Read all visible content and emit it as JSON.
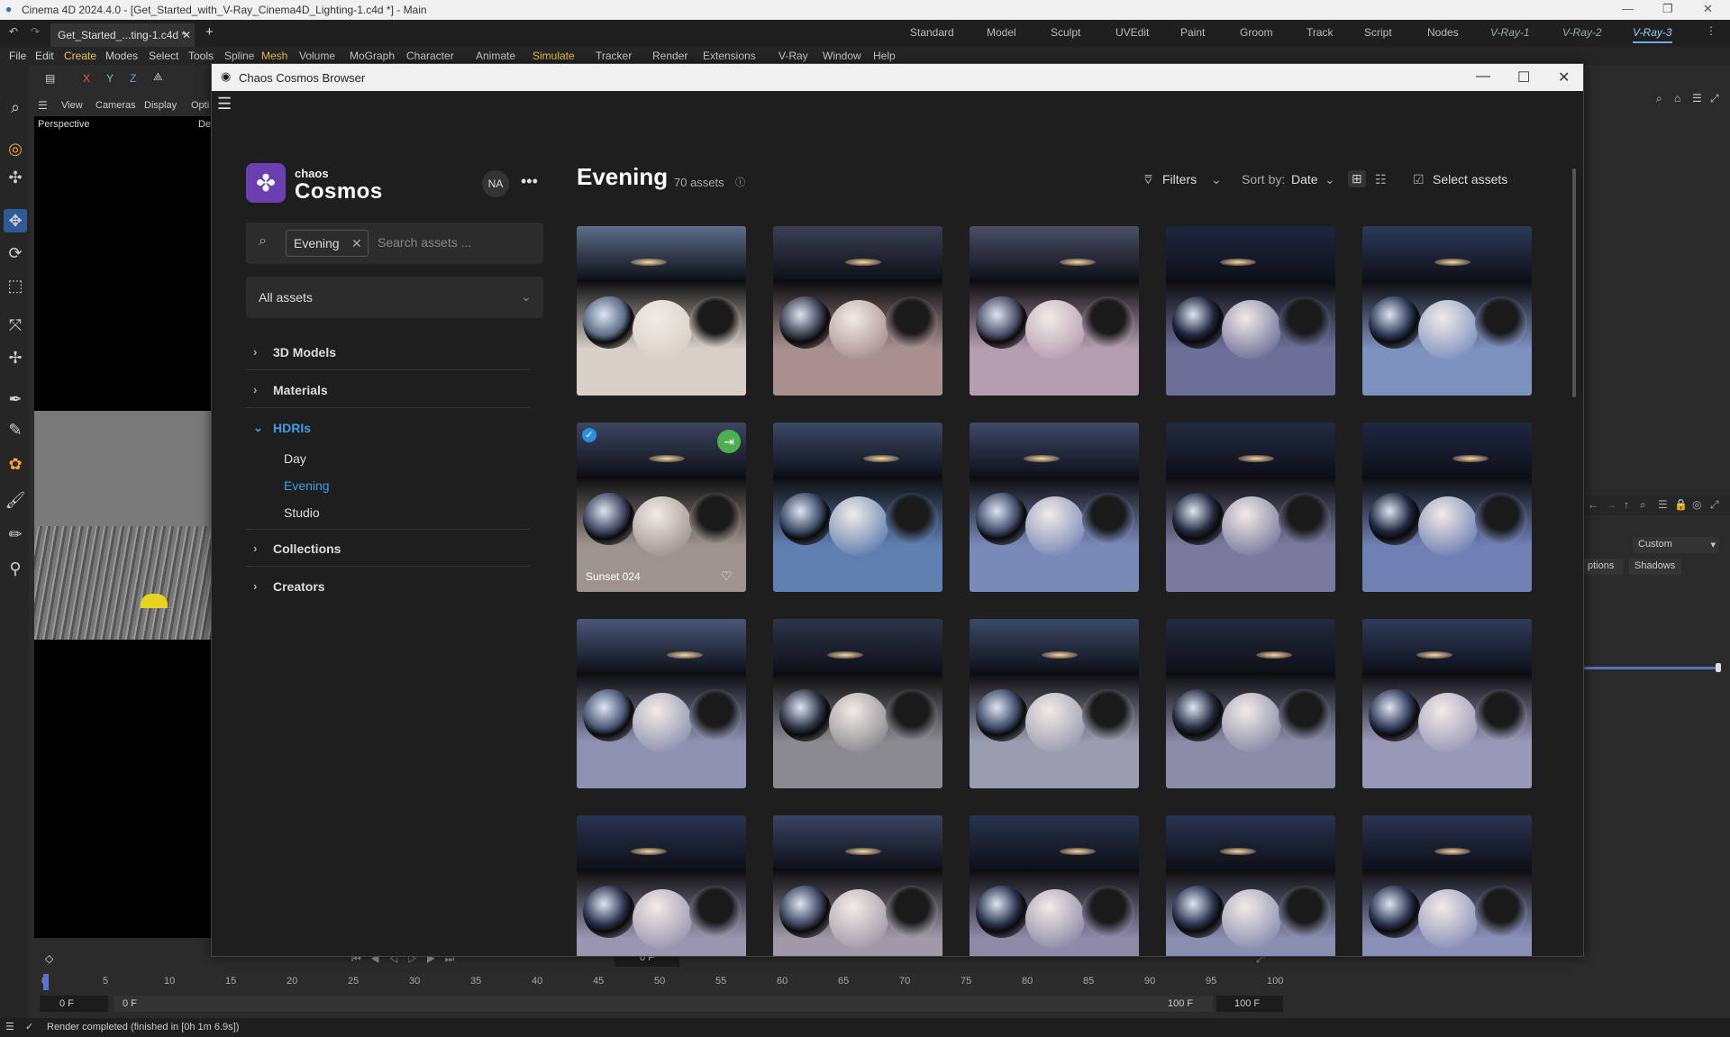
{
  "window": {
    "title": "Cinema 4D 2024.4.0 - [Get_Started_with_V-Ray_Cinema4D_Lighting-1.c4d *] - Main",
    "doc_tab": "Get_Started_...ting-1.c4d *",
    "layouts": [
      "Standard",
      "Model",
      "Sculpt",
      "UVEdit",
      "Paint",
      "Groom",
      "Track",
      "Script",
      "Nodes",
      "V-Ray-1",
      "V-Ray-2",
      "V-Ray-3"
    ],
    "active_layout": "V-Ray-3"
  },
  "menu": [
    "File",
    "Edit",
    "Create",
    "Modes",
    "Select",
    "Tools",
    "Spline",
    "Mesh",
    "Volume",
    "MoGraph",
    "Character",
    "Animate",
    "Simulate",
    "Tracker",
    "Render",
    "Extensions",
    "V-Ray",
    "Window",
    "Help"
  ],
  "viewport": {
    "menus": [
      "View",
      "Cameras",
      "Display",
      "Opti"
    ],
    "label": "Perspective",
    "label_right": "De"
  },
  "right_panel": {
    "dropdown": "Custom",
    "tab1": "ptions",
    "tab2": "Shadows"
  },
  "timeline": {
    "frame_field": "0 F",
    "ticks": [
      "0",
      "5",
      "10",
      "15",
      "20",
      "25",
      "30",
      "35",
      "40",
      "45",
      "50",
      "55",
      "60",
      "65",
      "70",
      "75",
      "80",
      "85",
      "90",
      "95",
      "100"
    ],
    "start": "0 F",
    "start2": "0 F",
    "end": "100 F",
    "end2": "100 F"
  },
  "status": {
    "text": "Render completed (finished in [0h  1m  6.9s])"
  },
  "dialog": {
    "title": "Chaos Cosmos Browser",
    "brand_small": "chaos",
    "brand": "Cosmos",
    "avatar": "NA",
    "search_chip": "Evening",
    "search_placeholder": "Search assets ...",
    "all_assets": "All assets",
    "categories": [
      "3D Models",
      "Materials",
      "HDRIs",
      "Collections",
      "Creators"
    ],
    "hdri_sub": [
      "Day",
      "Evening",
      "Studio"
    ],
    "grid_title": "Evening",
    "grid_count": "70 assets",
    "filters": "Filters",
    "sort_label": "Sort by:",
    "sort_value": "Date",
    "select_assets": "Select assets",
    "hovered_tile_label": "Sunset 024"
  },
  "tile_colors": {
    "row1": [
      [
        "#5d6e88",
        "#d8cfc8"
      ],
      [
        "#3a3f52",
        "#a89090"
      ],
      [
        "#4b4f66",
        "#b59eb0"
      ],
      [
        "#1f2740",
        "#6d6f99"
      ],
      [
        "#2c3a58",
        "#7e92c0"
      ]
    ],
    "row2": [
      [
        "#3e4660",
        "#9e938e"
      ],
      [
        "#3b4a66",
        "#5f7fb0"
      ],
      [
        "#3e4a68",
        "#7a8ab8"
      ],
      [
        "#222a40",
        "#7a7a9e"
      ],
      [
        "#1f2842",
        "#6f80b4"
      ]
    ],
    "row3": [
      [
        "#4a5878",
        "#8e92b0"
      ],
      [
        "#2e3448",
        "#8b8a90"
      ],
      [
        "#3c4a66",
        "#9a9cb0"
      ],
      [
        "#232a3e",
        "#8a8ca8"
      ],
      [
        "#2f3b5a",
        "#9a98b8"
      ]
    ],
    "row4": [
      [
        "#2a3450",
        "#9a96b0"
      ],
      [
        "#3a4460",
        "#a09aa8"
      ],
      [
        "#28334e",
        "#8e8aa8"
      ],
      [
        "#2a3450",
        "#8a8eb0"
      ],
      [
        "#2a3452",
        "#8a90b8"
      ]
    ]
  }
}
